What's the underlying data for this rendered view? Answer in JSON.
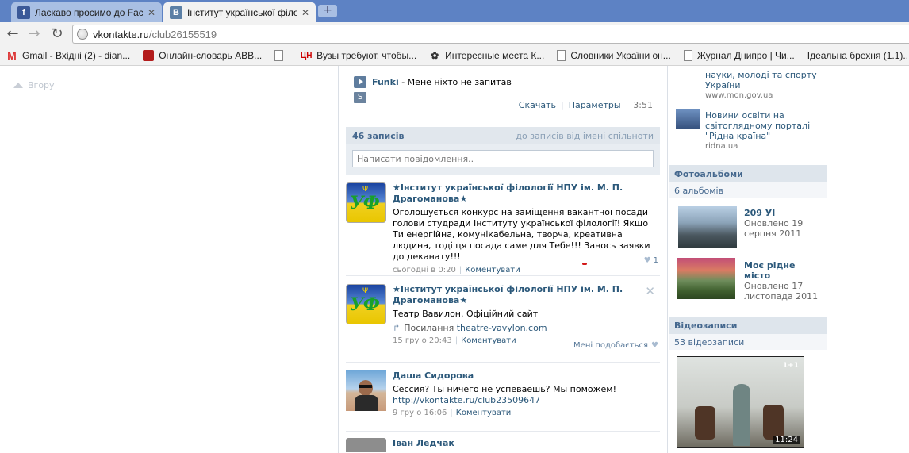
{
  "browser": {
    "tabs": [
      {
        "title": "Ласкаво просимо до Face...",
        "favicon": "f",
        "favicon_color": "#3b5998",
        "active": false
      },
      {
        "title": "Інститут української філо...",
        "favicon": "B",
        "favicon_color": "#5b7fa6",
        "active": true
      }
    ],
    "new_tab": "+",
    "url_host": "vkontakte.ru",
    "url_path": "/club26155519",
    "bookmarks": [
      {
        "label": "Gmail - Вхідні (2) - dian...",
        "icon": "gmail-icon"
      },
      {
        "label": "Онлайн-словарь ABB...",
        "icon": "book-icon"
      },
      {
        "label": "",
        "icon": "page-icon"
      },
      {
        "label": "Вузы требуют, чтобы...",
        "icon": "cn-icon",
        "icon_text": "ЦН"
      },
      {
        "label": "Интересные места К...",
        "icon": "pin-icon"
      },
      {
        "label": "Словники України он...",
        "icon": "page-icon"
      },
      {
        "label": "Журнал Днипро | Чи...",
        "icon": "page-icon"
      },
      {
        "label": "Ідеальна брехня (1.1)...",
        "icon": "none"
      }
    ]
  },
  "page": {
    "back_to_top": "Вгору",
    "audio": {
      "artist": "Funki",
      "title": " - Мене ніхто не запитав",
      "s_label": "S",
      "download": "Скачать",
      "params": "Параметры",
      "duration": "3:51"
    },
    "wall": {
      "count": "46 записів",
      "owner_filter": "до записів від імені спільноти",
      "input_placeholder": "Написати повідомлення.."
    },
    "posts": [
      {
        "author": "★Інститут української філології НПУ ім. М. П. Драгоманова★",
        "text": "Оголошується конкурс на заміщення вакантної посади голови студради Інституту української філології! Якщо Ти енергійна, комунікабельна, творча, креативна людина, тоді ця посада саме для Тебе!!! ",
        "text_highlight": "Занось заявки до деканату!!!",
        "date": "сьогодні в 0:20",
        "comment": "Коментувати",
        "likes": "1"
      },
      {
        "author": "★Інститут української філології НПУ ім. М. П. Драгоманова★",
        "text": "Театр Вавилон. Офіційний сайт",
        "link_label": "Посилання",
        "link_url": "theatre-vavylon.com",
        "date": "15 гру о 20:43",
        "comment": "Коментувати",
        "like_text": "Мені подобається"
      },
      {
        "author": "Даша Сидорова",
        "text": "Сессия? Ты ничего не успеваешь? Мы поможем!",
        "url": "http://vkontakte.ru/club23509647",
        "date": "9 гру о 16:06",
        "comment": "Коментувати"
      },
      {
        "author": "Іван Ледчак"
      }
    ],
    "sidebar": {
      "news": [
        {
          "text": "науки, молоді та спорту України",
          "domain": "www.mon.gov.ua"
        },
        {
          "text": "Новини освіти на світоглядному порталі \"Рідна країна\"",
          "domain": "ridna.ua"
        }
      ],
      "albums_head": "Фотоальбоми",
      "albums_count": "6 альбомів",
      "albums": [
        {
          "title": "209 УІ",
          "date": "Оновлено 19 серпня 2011"
        },
        {
          "title": "Моє рідне місто",
          "date": "Оновлено 17 листопада 2011"
        }
      ],
      "videos_head": "Відеозаписи",
      "videos_count": "53 відеозаписи",
      "video_logo": "1+1",
      "video_time": "11:24"
    }
  }
}
